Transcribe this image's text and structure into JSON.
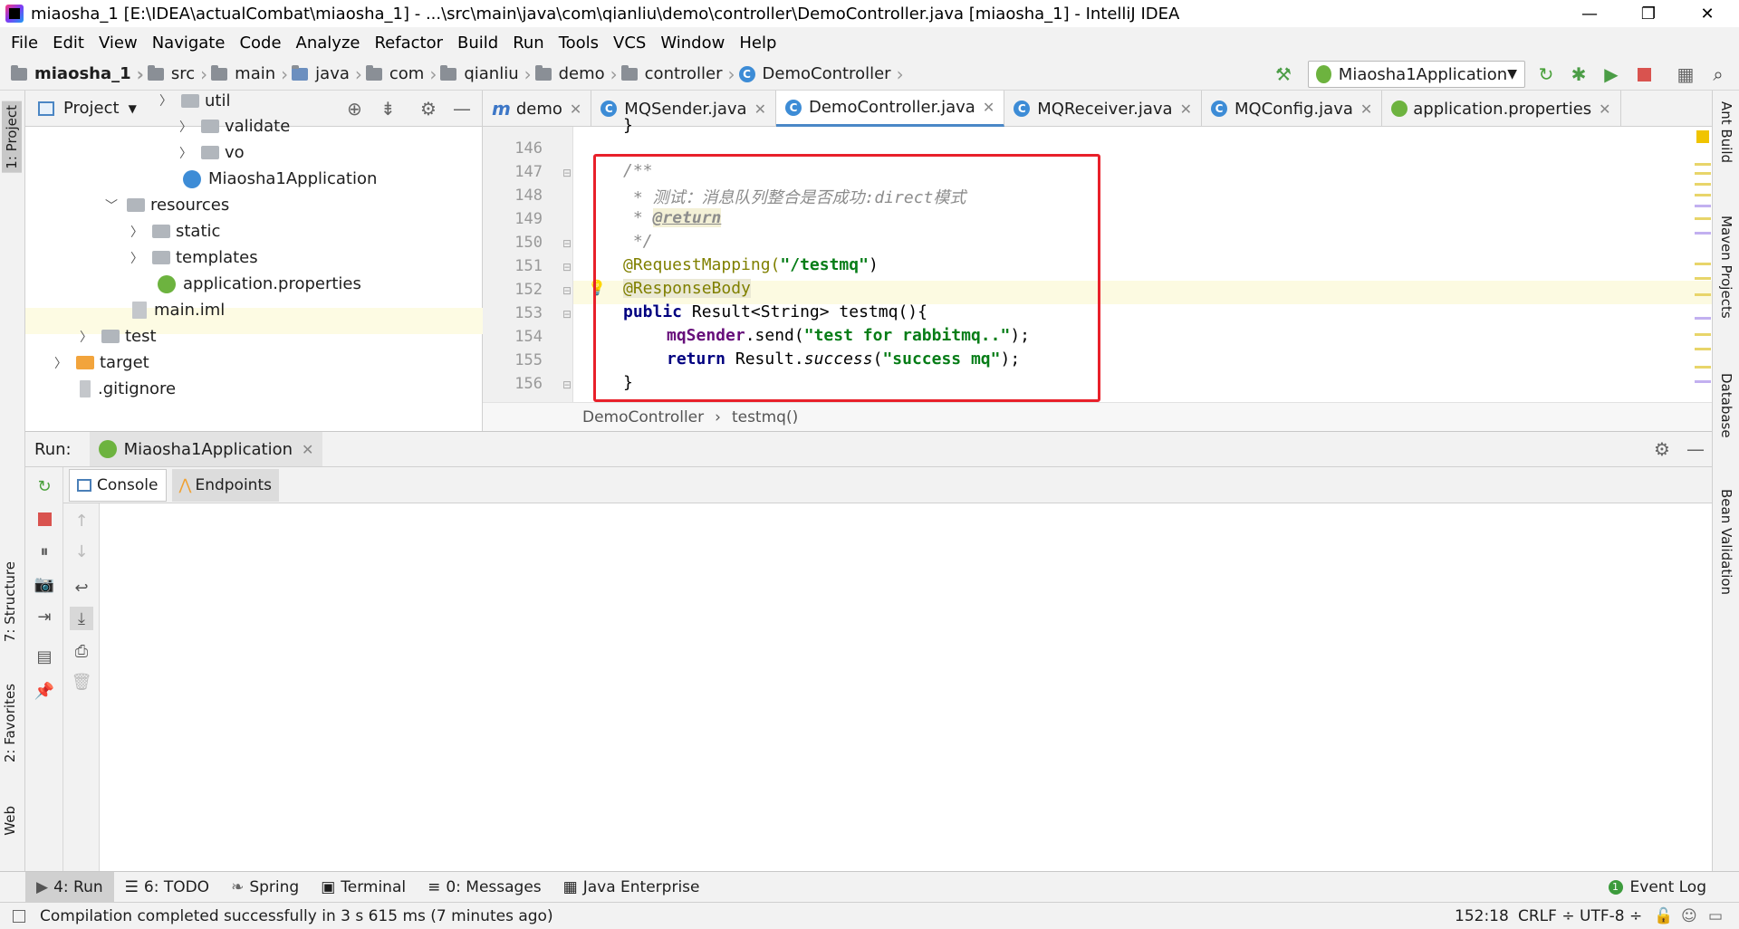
{
  "window": {
    "title": "miaosha_1 [E:\\IDEA\\actualCombat\\miaosha_1] - ...\\src\\main\\java\\com\\qianliu\\demo\\controller\\DemoController.java [miaosha_1] - IntelliJ IDEA",
    "minimize": "—",
    "restore": "❐",
    "close": "✕"
  },
  "menu": [
    "File",
    "Edit",
    "View",
    "Navigate",
    "Code",
    "Analyze",
    "Refactor",
    "Build",
    "Run",
    "Tools",
    "VCS",
    "Window",
    "Help"
  ],
  "breadcrumb": [
    "miaosha_1",
    "src",
    "main",
    "java",
    "com",
    "qianliu",
    "demo",
    "controller",
    "DemoController"
  ],
  "run_config": "Miaosha1Application",
  "left_tabs": [
    "1: Project",
    "7: Structure",
    "2: Favorites",
    "Web"
  ],
  "right_tabs": [
    "Ant Build",
    "Maven Projects",
    "Database",
    "Bean Validation"
  ],
  "project": {
    "header": "Project",
    "tree": [
      {
        "label": "util"
      },
      {
        "label": "validate"
      },
      {
        "label": "vo"
      },
      {
        "label": "Miaosha1Application"
      },
      {
        "label": "resources"
      },
      {
        "label": "static"
      },
      {
        "label": "templates"
      },
      {
        "label": "application.properties"
      },
      {
        "label": "main.iml"
      },
      {
        "label": "test"
      },
      {
        "label": "target"
      },
      {
        "label": ".gitignore"
      }
    ]
  },
  "editor_tabs": [
    {
      "label": "demo"
    },
    {
      "label": "MQSender.java"
    },
    {
      "label": "DemoController.java"
    },
    {
      "label": "MQReceiver.java"
    },
    {
      "label": "MQConfig.java"
    },
    {
      "label": "application.properties"
    }
  ],
  "code": {
    "lines": [
      "146",
      "147",
      "148",
      "149",
      "150",
      "151",
      "152",
      "153",
      "154",
      "155",
      "156"
    ],
    "l146": "}",
    "l147": "/**",
    "l148": " * 测试：消息队列整合是否成功:direct模式",
    "l149_prefix": " * ",
    "l149_tag": "@return",
    "l150": " */",
    "l151_ann": "@RequestMapping(",
    "l151_str": "\"/testmq\"",
    "l151_end": ")",
    "l152": "@ResponseBody",
    "l153_kw": "public",
    "l153_rest": " Result<String> testmq(){",
    "l154_field": "mqSender",
    "l154_mid": ".send(",
    "l154_str": "\"test for rabbitmq..\"",
    "l154_end": ");",
    "l155_kw": "return",
    "l155_mid": " Result.",
    "l155_ital": "success",
    "l155_open": "(",
    "l155_str": "\"success mq\"",
    "l155_end": ");",
    "l156": "}"
  },
  "editor_breadcrumb": {
    "class": "DemoController",
    "method": "testmq()",
    "sep": "›"
  },
  "run": {
    "label": "Run:",
    "tab": "Miaosha1Application",
    "console_tabs": [
      "Console",
      "Endpoints"
    ]
  },
  "tool_windows": [
    {
      "label": "4: Run"
    },
    {
      "label": "6: TODO"
    },
    {
      "label": "Spring"
    },
    {
      "label": "Terminal"
    },
    {
      "label": "0: Messages"
    },
    {
      "label": "Java Enterprise"
    }
  ],
  "event_log": "Event Log",
  "status": {
    "message": "Compilation completed successfully in 3 s 615 ms (7 minutes ago)",
    "position": "152:18",
    "line_sep": "CRLF ÷",
    "encoding": "UTF-8 ÷"
  },
  "colors": {
    "accent": "#4a88c7",
    "highlight_box": "#e8202a"
  }
}
